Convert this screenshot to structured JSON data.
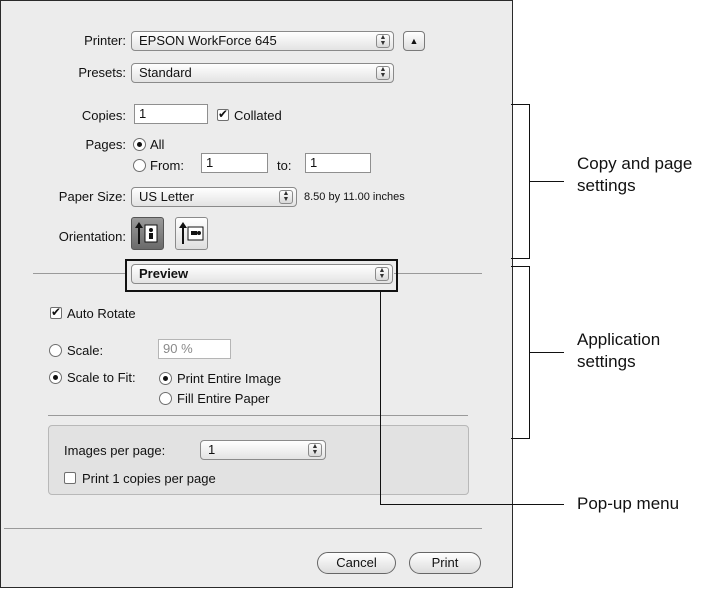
{
  "printer": {
    "label": "Printer:",
    "value": "EPSON WorkForce 645"
  },
  "presets": {
    "label": "Presets:",
    "value": "Standard"
  },
  "copies": {
    "label": "Copies:",
    "value": "1",
    "collated_label": "Collated",
    "collated_checked": true
  },
  "pages": {
    "label": "Pages:",
    "all_label": "All",
    "from_label": "From:",
    "from_value": "1",
    "to_label": "to:",
    "to_value": "1",
    "selected": "All"
  },
  "paper_size": {
    "label": "Paper Size:",
    "value": "US Letter",
    "dimensions": "8.50 by 11.00 inches"
  },
  "orientation": {
    "label": "Orientation:",
    "selected": "portrait"
  },
  "panel_menu": {
    "value": "Preview"
  },
  "auto_rotate": {
    "label": "Auto Rotate",
    "checked": true
  },
  "scale": {
    "label": "Scale:",
    "value": "90 %"
  },
  "scale_to_fit": {
    "label": "Scale to Fit:",
    "option1": "Print Entire Image",
    "option2": "Fill Entire Paper",
    "selected": "Print Entire Image"
  },
  "images_per_page": {
    "label": "Images per page:",
    "value": "1"
  },
  "print_copies_per_page": {
    "label": "Print 1 copies per page",
    "checked": false
  },
  "buttons": {
    "cancel": "Cancel",
    "print": "Print"
  },
  "callouts": {
    "copy_page": "Copy and page settings",
    "application": "Application settings",
    "popup": "Pop-up menu"
  },
  "colors": {
    "dialog_bg": "#ececec",
    "border": "#2a2a2a"
  }
}
